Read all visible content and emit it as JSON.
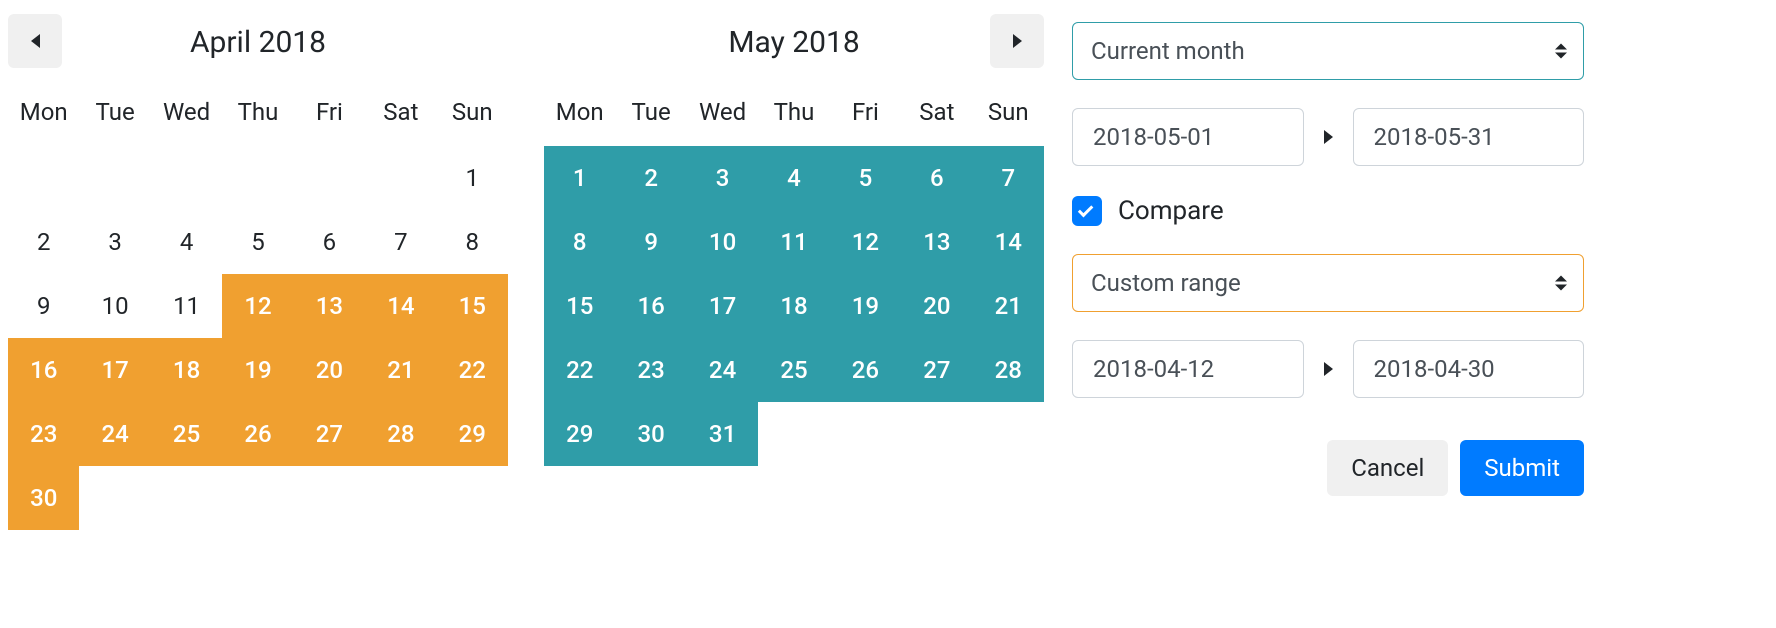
{
  "calendars": {
    "weekdays": [
      "Mon",
      "Tue",
      "Wed",
      "Thu",
      "Fri",
      "Sat",
      "Sun"
    ],
    "left": {
      "title": "April 2018",
      "leading_blanks": 6,
      "days": 30,
      "highlight": {
        "start": 12,
        "end": 30,
        "color": "#f0a030"
      }
    },
    "right": {
      "title": "May 2018",
      "leading_blanks": 0,
      "days": 31,
      "highlight": {
        "start": 1,
        "end": 31,
        "color": "#2f9da8"
      }
    }
  },
  "controls": {
    "preset_primary": "Current month",
    "primary_start": "2018-05-01",
    "primary_end": "2018-05-31",
    "compare_checked": true,
    "compare_label": "Compare",
    "preset_compare": "Custom range",
    "compare_start": "2018-04-12",
    "compare_end": "2018-04-30",
    "cancel_label": "Cancel",
    "submit_label": "Submit"
  },
  "colors": {
    "primary_highlight": "#2f9da8",
    "compare_highlight": "#f0a030",
    "checkbox": "#007bff",
    "submit": "#007bff"
  }
}
